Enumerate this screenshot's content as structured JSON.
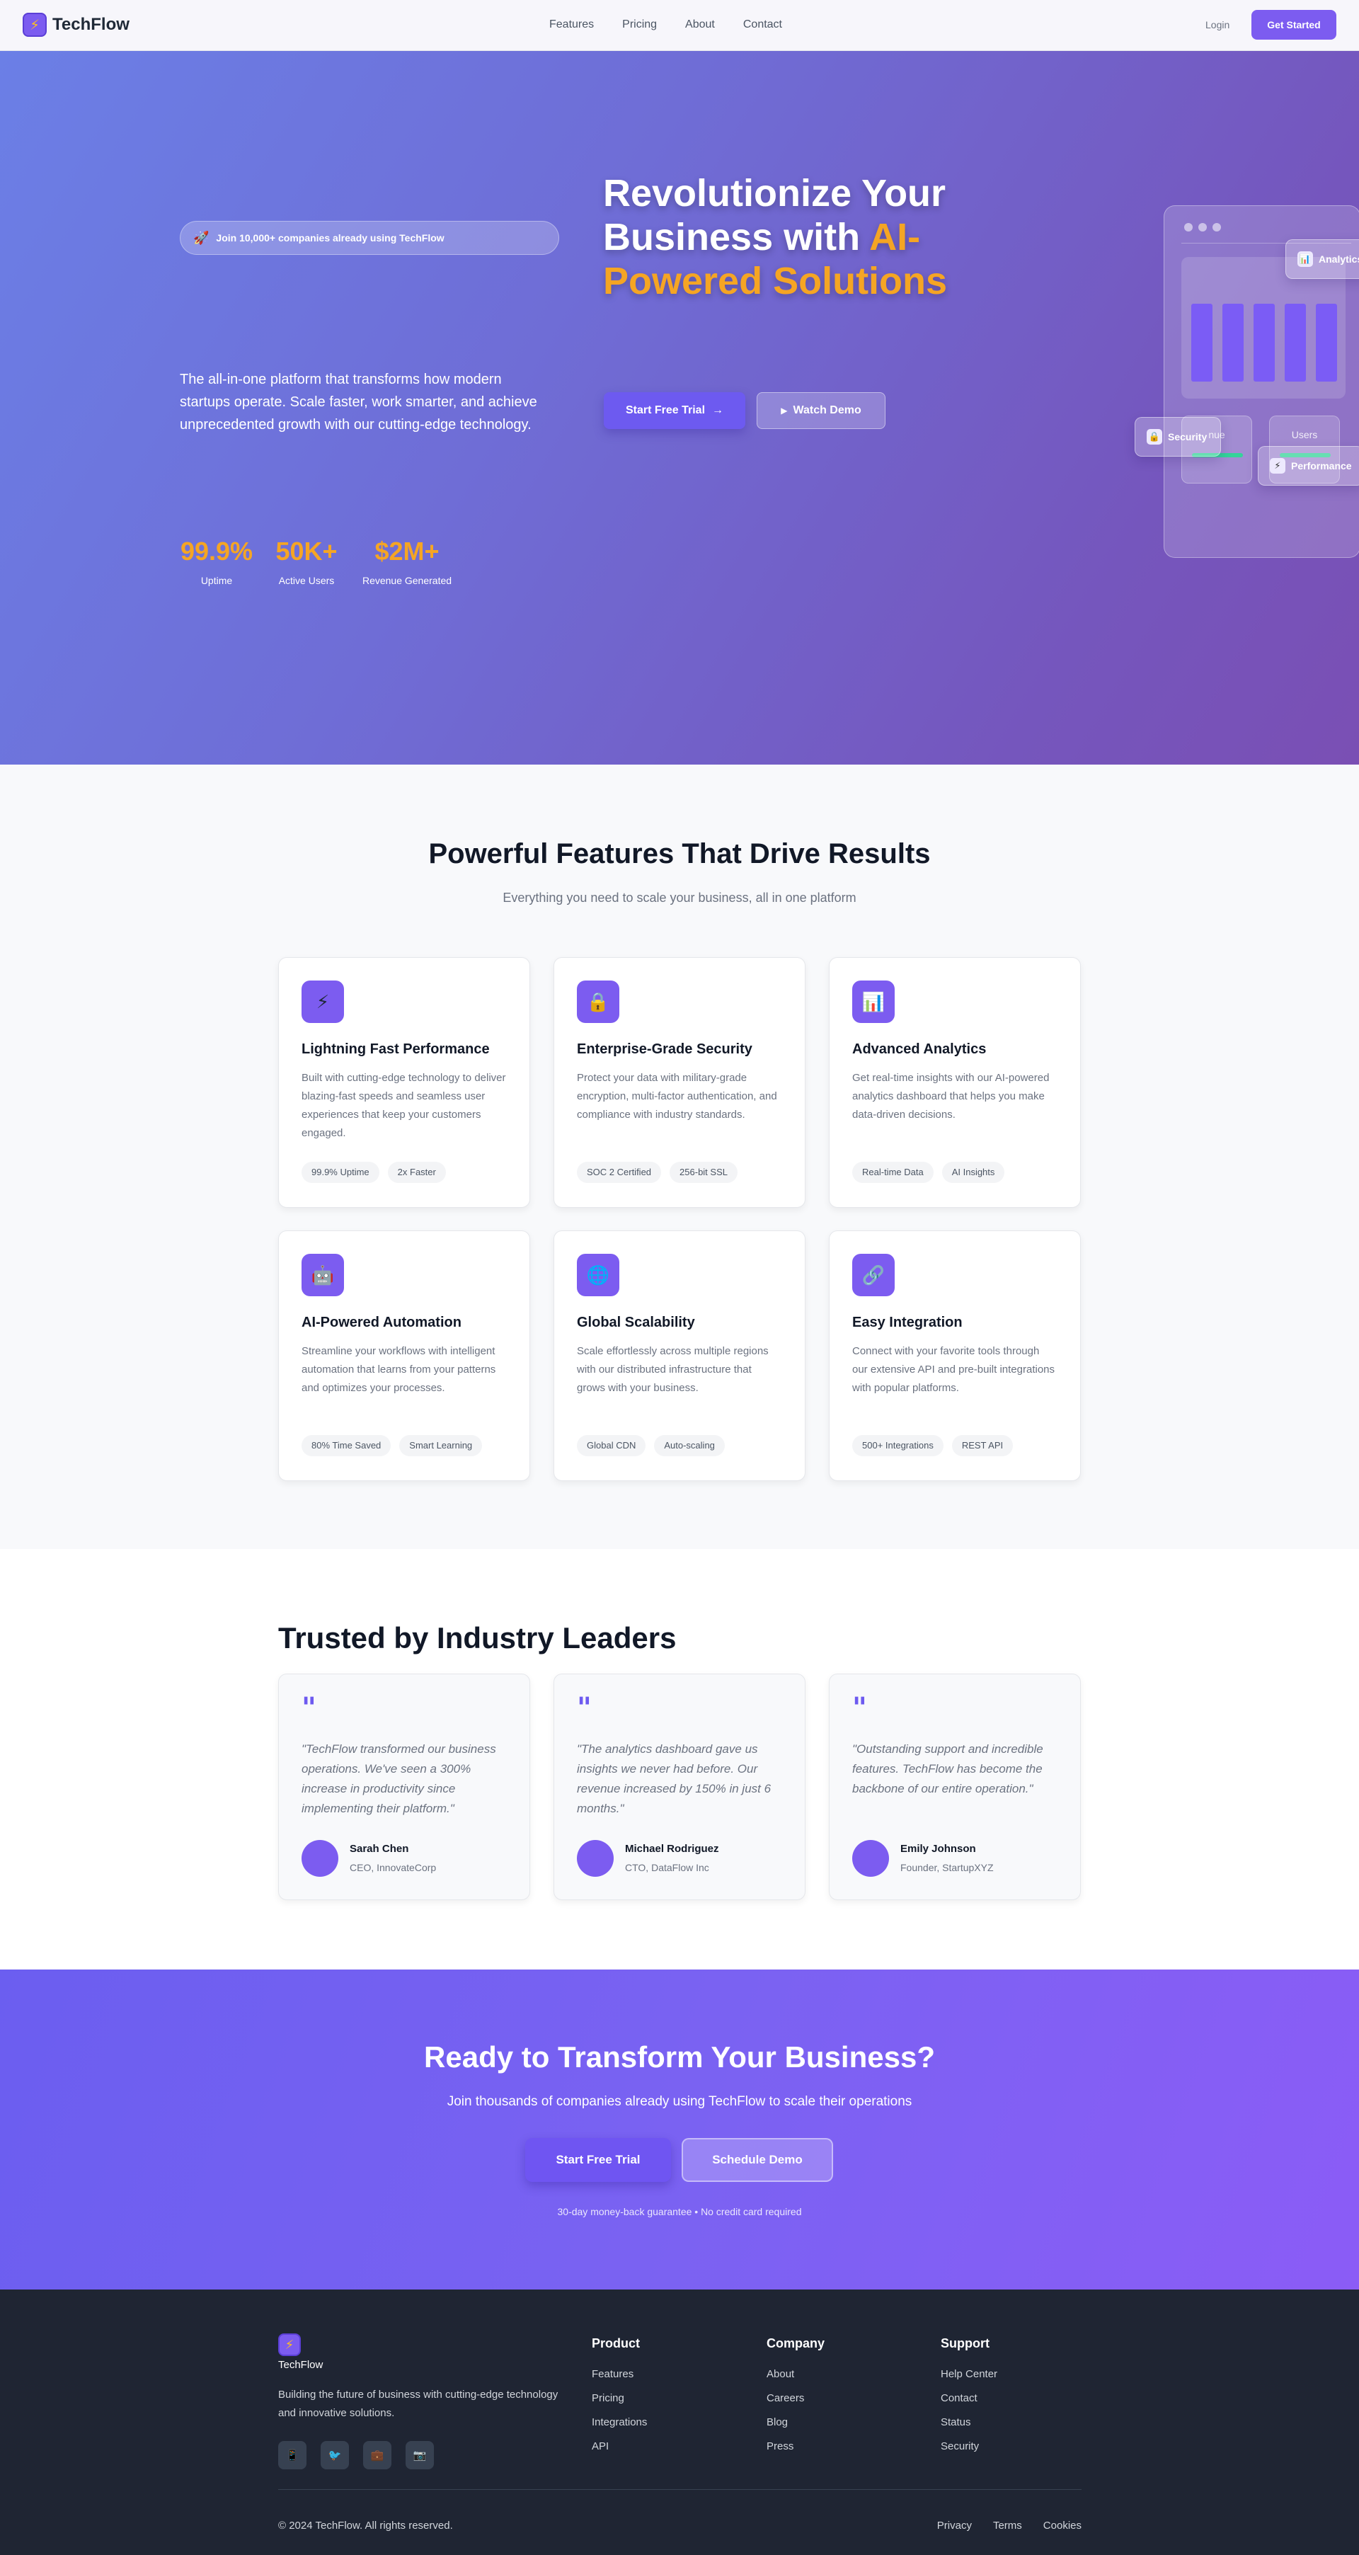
{
  "nav": {
    "logo_icon": "lightning-icon",
    "brand": "TechFlow",
    "links": [
      "Features",
      "Pricing",
      "About",
      "Contact"
    ],
    "login": "Login",
    "cta": "Get Started"
  },
  "hero": {
    "badge": "Join 10,000+ companies already using TechFlow",
    "badge_icon": "rocket-icon",
    "title_main": "Revolutionize Your Business with ",
    "title_accent": "AI-Powered Solutions",
    "description": "The all-in-one platform that transforms how modern startups operate. Scale faster, work smarter, and achieve unprecedented growth with our cutting-edge technology.",
    "primary_button": "Start Free Trial",
    "primary_arrow": "→",
    "secondary_button": "Watch Demo",
    "secondary_icon": "▶",
    "stats": [
      {
        "value": "99.9%",
        "label": "Uptime"
      },
      {
        "value": "50K+",
        "label": "Active Users"
      },
      {
        "value": "$2M+",
        "label": "Revenue Generated"
      }
    ],
    "mockup": {
      "mini_cards": [
        "nue",
        "Users"
      ],
      "float_analytics": "Analytics",
      "float_security": "Security",
      "float_performance": "Performance"
    },
    "accent_color": "#f5a524"
  },
  "features": {
    "title": "Powerful Features That Drive Results",
    "subtitle": "Everything you need to scale your business, all in one platform",
    "cards": [
      {
        "icon": "⚡",
        "title": "Lightning Fast Performance",
        "desc": "Built with cutting-edge technology to deliver blazing-fast speeds and seamless user experiences that keep your customers engaged.",
        "tags": [
          "99.9% Uptime",
          "2x Faster"
        ]
      },
      {
        "icon": "🔒",
        "title": "Enterprise-Grade Security",
        "desc": "Protect your data with military-grade encryption, multi-factor authentication, and compliance with industry standards.",
        "tags": [
          "SOC 2 Certified",
          "256-bit SSL"
        ]
      },
      {
        "icon": "📊",
        "title": "Advanced Analytics",
        "desc": "Get real-time insights with our AI-powered analytics dashboard that helps you make data-driven decisions.",
        "tags": [
          "Real-time Data",
          "AI Insights"
        ]
      },
      {
        "icon": "🤖",
        "title": "AI-Powered Automation",
        "desc": "Streamline your workflows with intelligent automation that learns from your patterns and optimizes your processes.",
        "tags": [
          "80% Time Saved",
          "Smart Learning"
        ]
      },
      {
        "icon": "🌐",
        "title": "Global Scalability",
        "desc": "Scale effortlessly across multiple regions with our distributed infrastructure that grows with your business.",
        "tags": [
          "Global CDN",
          "Auto-scaling"
        ]
      },
      {
        "icon": "🔗",
        "title": "Easy Integration",
        "desc": "Connect with your favorite tools through our extensive API and pre-built integrations with popular platforms.",
        "tags": [
          "500+ Integrations",
          "REST API"
        ]
      }
    ]
  },
  "testimonials": {
    "title": "Trusted by Industry Leaders",
    "quote_mark": "\"",
    "items": [
      {
        "quote": "\"TechFlow transformed our business operations. We've seen a 300% increase in productivity since implementing their platform.\"",
        "name": "Sarah Chen",
        "role": "CEO, InnovateCorp"
      },
      {
        "quote": "\"The analytics dashboard gave us insights we never had before. Our revenue increased by 150% in just 6 months.\"",
        "name": "Michael Rodriguez",
        "role": "CTO, DataFlow Inc"
      },
      {
        "quote": "\"Outstanding support and incredible features. TechFlow has become the backbone of our entire operation.\"",
        "name": "Emily Johnson",
        "role": "Founder, StartupXYZ"
      }
    ]
  },
  "cta": {
    "title": "Ready to Transform Your Business?",
    "subtitle": "Join thousands of companies already using TechFlow to scale their operations",
    "primary": "Start Free Trial",
    "secondary": "Schedule Demo",
    "note": "30-day money-back guarantee • No credit card required"
  },
  "footer": {
    "brand": "TechFlow",
    "description": "Building the future of business with cutting-edge technology and innovative solutions.",
    "social_icons": [
      "📱",
      "🐦",
      "💼",
      "📷"
    ],
    "columns": [
      {
        "title": "Product",
        "links": [
          "Features",
          "Pricing",
          "Integrations",
          "API"
        ]
      },
      {
        "title": "Company",
        "links": [
          "About",
          "Careers",
          "Blog",
          "Press"
        ]
      },
      {
        "title": "Support",
        "links": [
          "Help Center",
          "Contact",
          "Status",
          "Security"
        ]
      }
    ],
    "copyright": "© 2024 TechFlow. All rights reserved.",
    "legal": [
      "Privacy",
      "Terms",
      "Cookies"
    ]
  }
}
